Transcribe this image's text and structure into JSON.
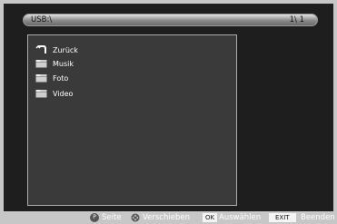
{
  "path_bar": {
    "path": "USB:\\",
    "page": "1\\ 1"
  },
  "file_list": [
    {
      "name": "Zurück",
      "icon": "back-arrow-icon"
    },
    {
      "name": "Musik",
      "icon": "folder-icon"
    },
    {
      "name": "Foto",
      "icon": "folder-icon"
    },
    {
      "name": "Video",
      "icon": "folder-icon"
    }
  ],
  "footer": {
    "seite_key": "P",
    "seite_label": "Seite",
    "verschieben_label": "Verschieben",
    "ok_key": "OK",
    "auswaehlen_label": "Auswählen",
    "exit_key": "EXIT",
    "beenden_label": "Beenden"
  }
}
